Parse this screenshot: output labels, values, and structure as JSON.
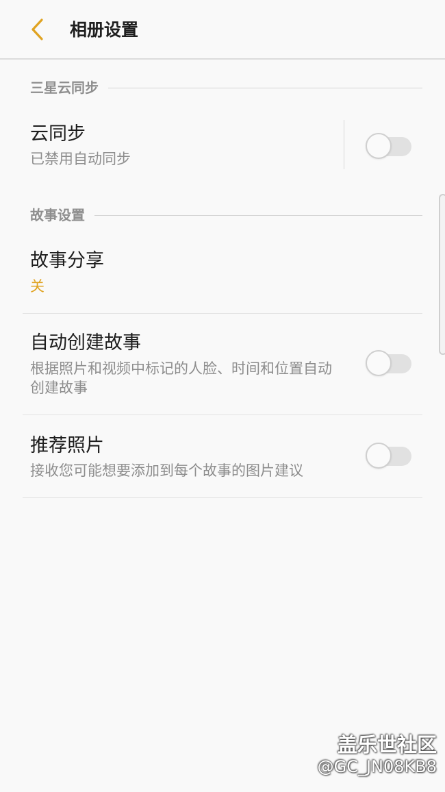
{
  "header": {
    "title": "相册设置",
    "back_icon": "chevron-left-icon",
    "accent_color": "#e0a321"
  },
  "sections": {
    "samsung_cloud": {
      "title": "三星云同步",
      "items": [
        {
          "title": "云同步",
          "subtitle": "已禁用自动同步",
          "toggle": false
        }
      ]
    },
    "story": {
      "title": "故事设置",
      "items": [
        {
          "title": "故事分享",
          "value": "关"
        },
        {
          "title": "自动创建故事",
          "subtitle": "根据照片和视频中标记的人脸、时间和位置自动创建故事",
          "toggle": false
        },
        {
          "title": "推荐照片",
          "subtitle": "接收您可能想要添加到每个故事的图片建议",
          "toggle": false
        }
      ]
    }
  },
  "watermark": {
    "site": "盖乐世社区",
    "user": "@GC_JN08KB8"
  }
}
